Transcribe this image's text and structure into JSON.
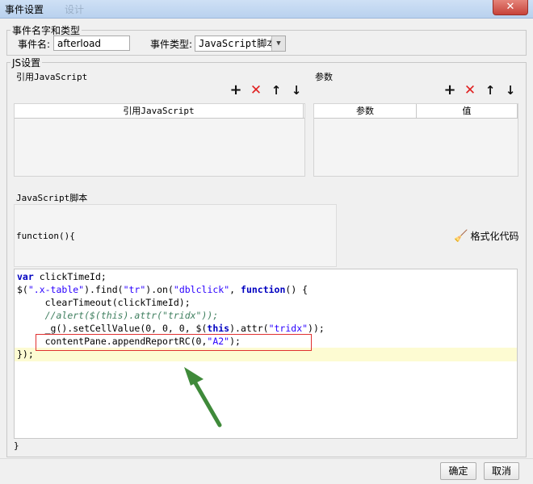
{
  "window": {
    "title": "事件设置",
    "ghost_title": "设计",
    "close_label": "✕"
  },
  "event_group": {
    "legend": "事件名字和类型",
    "name_label": "事件名:",
    "name_value": "afterload",
    "type_label": "事件类型:",
    "type_value": "JavaScript脚本"
  },
  "js_group": {
    "legend": "JS设置",
    "ref_js": {
      "title": "引用JavaScript",
      "column": "引用JavaScript"
    },
    "params": {
      "title": "参数",
      "columns": [
        "参数",
        "值"
      ]
    },
    "toolbar": {
      "add": "+",
      "remove": "✕",
      "up": "↑",
      "down": "↓"
    },
    "script_label": "JavaScript脚本",
    "function_header": "function(){",
    "format_label": "格式化代码",
    "footer_brace": "}"
  },
  "buttons": {
    "ok": "确定",
    "cancel": "取消"
  }
}
